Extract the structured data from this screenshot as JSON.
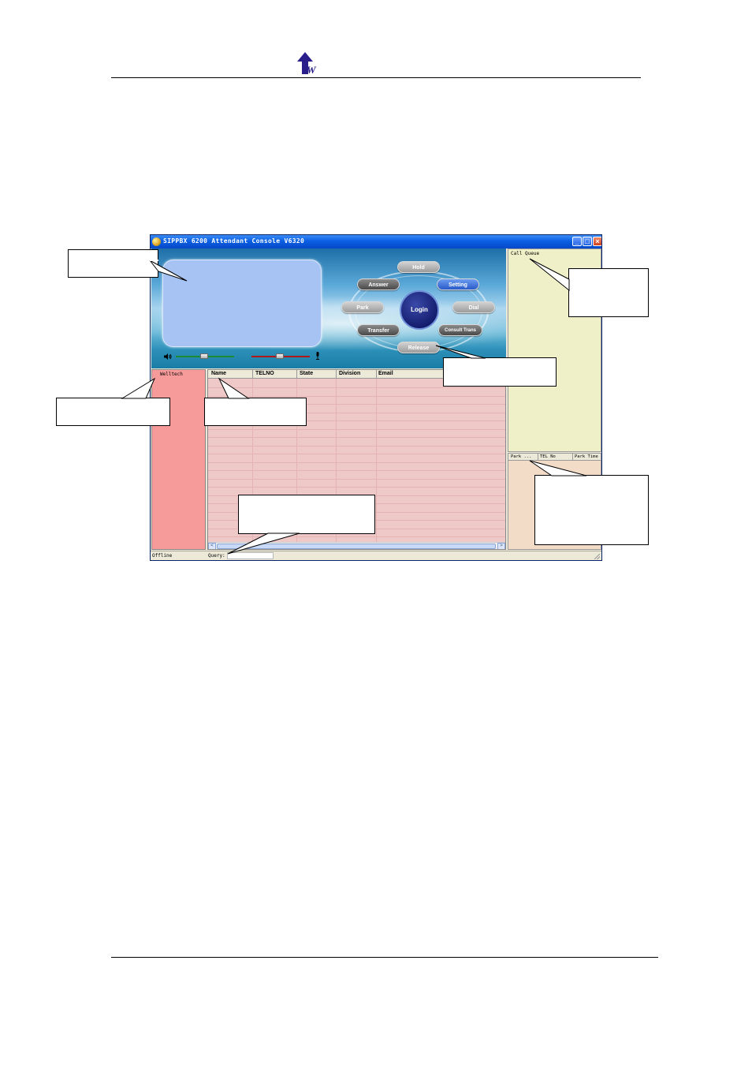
{
  "window": {
    "title": "SIPPBX 6200 Attendant Console V6320",
    "controls": {
      "minimize": "_",
      "maximize": "□",
      "close": "×"
    }
  },
  "console": {
    "buttons": {
      "hold": "Hold",
      "answer": "Answer",
      "setting": "Setting",
      "park": "Park",
      "login": "Login",
      "dial": "Dial",
      "transfer": "Transfer",
      "consult_trans": "Consult Trans",
      "release": "Release"
    },
    "icons": {
      "speaker": "speaker-icon",
      "microphone": "microphone-icon"
    }
  },
  "call_queue": {
    "label": "Call Queue"
  },
  "park_list": {
    "columns": [
      "Park ...",
      "TEL No",
      "Park Time"
    ]
  },
  "groups": {
    "root": "Welltech"
  },
  "directory": {
    "columns": [
      "Name",
      "TELNO",
      "State",
      "Division",
      "Email"
    ]
  },
  "statusbar": {
    "status": "Offline",
    "query_label": "Query:",
    "query_value": ""
  },
  "colors": {
    "group_pane": "#f79a9a",
    "table_bg": "#efc8c8",
    "call_queue_bg": "#f0f0c8",
    "park_bg": "#f2dcc8",
    "display_box": "#a6c3f4",
    "titlebar": "#0a5fe2"
  }
}
